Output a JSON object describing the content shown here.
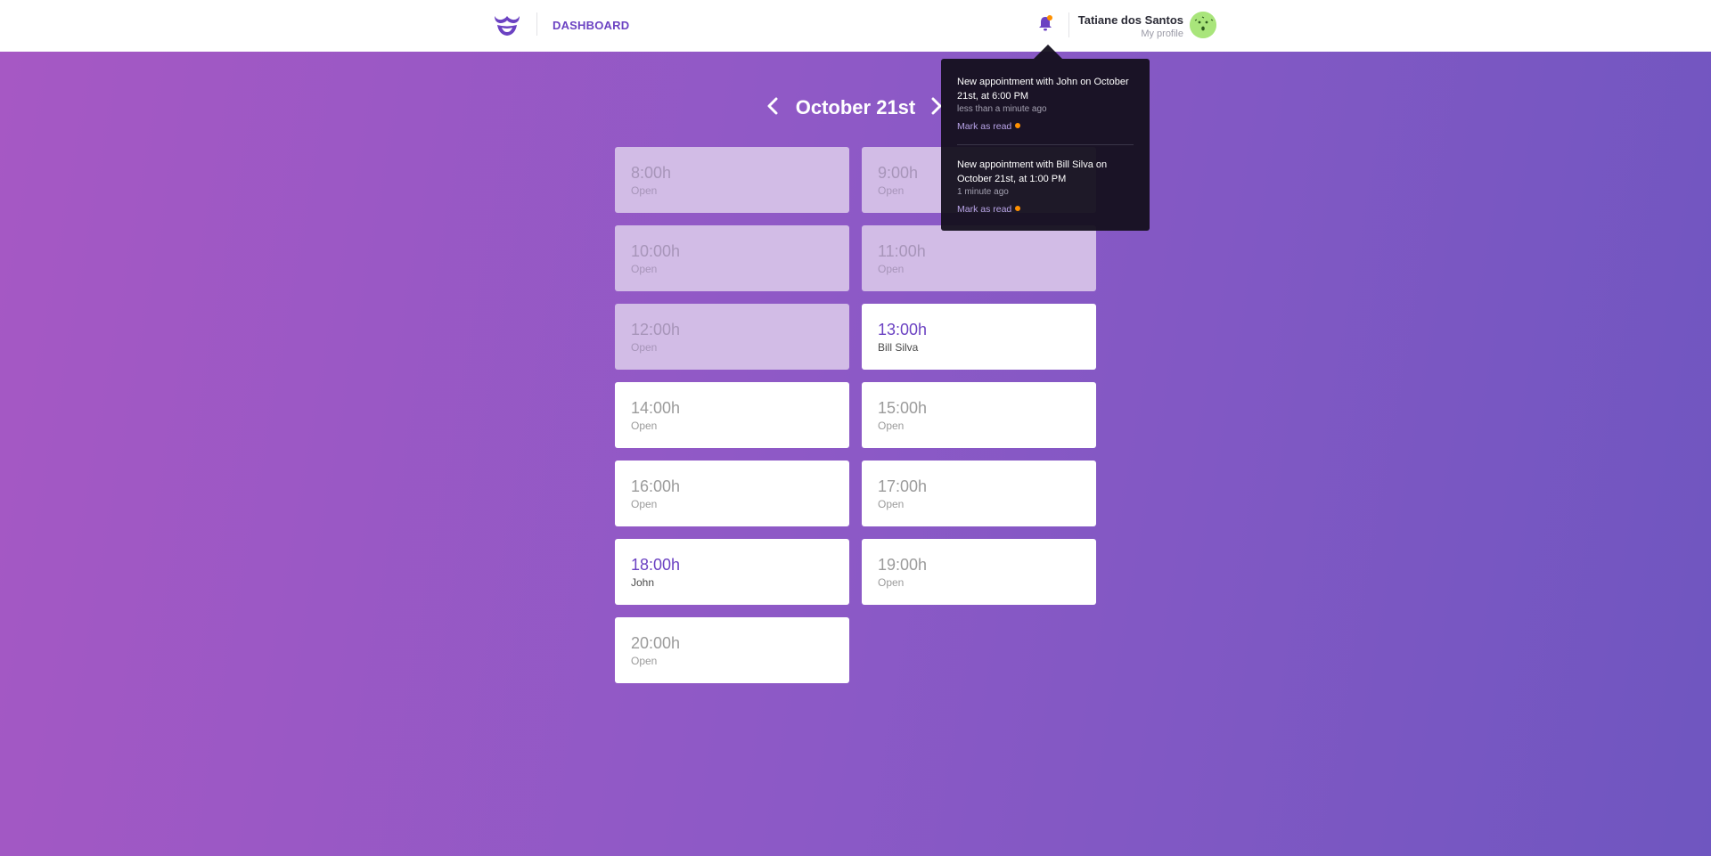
{
  "header": {
    "nav_label": "DASHBOARD",
    "user_name": "Tatiane dos Santos",
    "profile_link": "My profile"
  },
  "schedule": {
    "date_label": "October 21st",
    "slots": [
      {
        "time": "8:00h",
        "label": "Open",
        "state": "past"
      },
      {
        "time": "9:00h",
        "label": "Open",
        "state": "past"
      },
      {
        "time": "10:00h",
        "label": "Open",
        "state": "past"
      },
      {
        "time": "11:00h",
        "label": "Open",
        "state": "past"
      },
      {
        "time": "12:00h",
        "label": "Open",
        "state": "past"
      },
      {
        "time": "13:00h",
        "label": "Bill Silva",
        "state": "booked"
      },
      {
        "time": "14:00h",
        "label": "Open",
        "state": "open"
      },
      {
        "time": "15:00h",
        "label": "Open",
        "state": "open"
      },
      {
        "time": "16:00h",
        "label": "Open",
        "state": "open"
      },
      {
        "time": "17:00h",
        "label": "Open",
        "state": "open"
      },
      {
        "time": "18:00h",
        "label": "John",
        "state": "booked"
      },
      {
        "time": "19:00h",
        "label": "Open",
        "state": "open"
      },
      {
        "time": "20:00h",
        "label": "Open",
        "state": "open"
      }
    ]
  },
  "notifications": {
    "items": [
      {
        "text": "New appointment with John on October 21st, at 6:00 PM",
        "time": "less than a minute ago",
        "action": "Mark as read"
      },
      {
        "text": "New appointment with Bill Silva on October 21st, at 1:00 PM",
        "time": "1 minute ago",
        "action": "Mark as read"
      }
    ]
  },
  "colors": {
    "brand_purple": "#6b42c2",
    "gradient_start": "#a658c4",
    "gradient_end": "#6f56c0",
    "unread_dot": "#ff9000",
    "popover_bg": "#14101e"
  },
  "icons": {
    "logo": "mustache-logo-icon",
    "bell": "bell-icon",
    "prev": "chevron-left-icon",
    "next": "chevron-right-icon"
  }
}
